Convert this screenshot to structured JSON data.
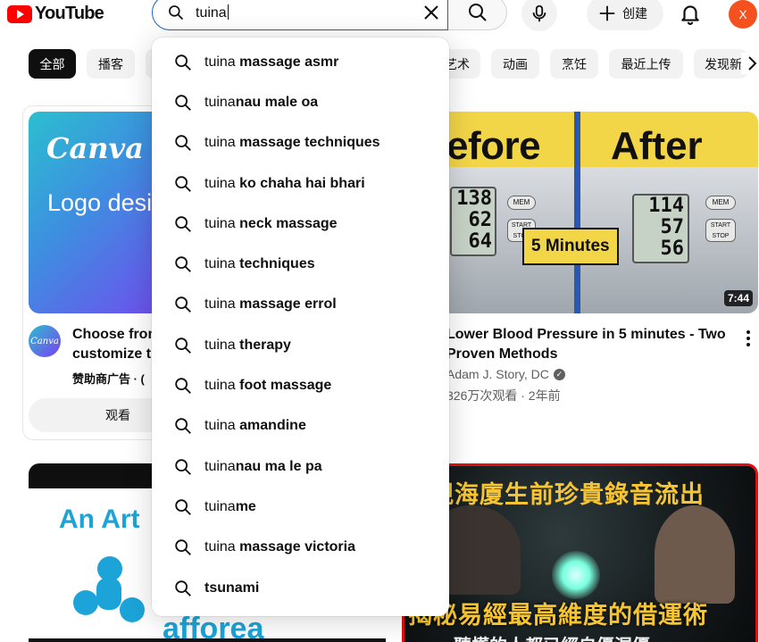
{
  "header": {
    "logo_text": "YouTube",
    "search_query": "tuina",
    "create_label": "创建",
    "avatar_letter": "X"
  },
  "chips": [
    {
      "label": "全部",
      "active": true
    },
    {
      "label": "播客",
      "active": false
    },
    {
      "label": "艺术",
      "active": false
    },
    {
      "label": "动画",
      "active": false
    },
    {
      "label": "烹饪",
      "active": false
    },
    {
      "label": "最近上传",
      "active": false
    },
    {
      "label": "发现新",
      "active": false
    }
  ],
  "suggestions": [
    {
      "typed": "tuina",
      "completion": " massage asmr"
    },
    {
      "typed": "tuina",
      "completion": "nau male oa"
    },
    {
      "typed": "tuina",
      "completion": " massage techniques"
    },
    {
      "typed": "tuina",
      "completion": " ko chaha hai bhari"
    },
    {
      "typed": "tuina",
      "completion": " neck massage"
    },
    {
      "typed": "tuina",
      "completion": " techniques"
    },
    {
      "typed": "tuina",
      "completion": " massage errol"
    },
    {
      "typed": "tuina",
      "completion": " therapy"
    },
    {
      "typed": "tuina",
      "completion": " foot massage"
    },
    {
      "typed": "tuina",
      "completion": " amandine"
    },
    {
      "typed": "tuina",
      "completion": "nau ma le pa"
    },
    {
      "typed": "tuina",
      "completion": "me"
    },
    {
      "typed": "tuina",
      "completion": " massage victoria"
    },
    {
      "typed": "",
      "completion": "tsunami"
    }
  ],
  "ad_card": {
    "brand": "Canva",
    "headline": "Logo designs? It's a bree",
    "avatar_text": "Canva",
    "title": "Choose from customize t",
    "meta": "赞助商广告 · (",
    "watch_label": "观看"
  },
  "video_card": {
    "thumb_before": "efore",
    "thumb_after": "After",
    "badge": "5 Minutes",
    "screen_left": [
      "138",
      "62",
      "64"
    ],
    "screen_right": [
      "114",
      "57",
      "56"
    ],
    "button_labels": [
      "MEM",
      "START STOP"
    ],
    "duration": "7:44",
    "title": "Lower Blood Pressure in 5 minutes - Two Proven Methods",
    "channel": "Adam J. Story, DC",
    "stats": "326万次观看 · 2年前"
  },
  "bottom_left": {
    "title_text": "An Art",
    "bottom_text": "afforea"
  },
  "bottom_right": {
    "top_text": "観海廈生前珍貴錄音流出",
    "bottom_text": "揭秘易經最高維度的借運術",
    "sub_text": "聽懂的人都已經自優渥優"
  },
  "colors": {
    "brand_red": "#ff0000",
    "search_border": "#1c62b9",
    "avatar_bg": "#f4511e",
    "chip_active_bg": "#0f0f0f"
  }
}
